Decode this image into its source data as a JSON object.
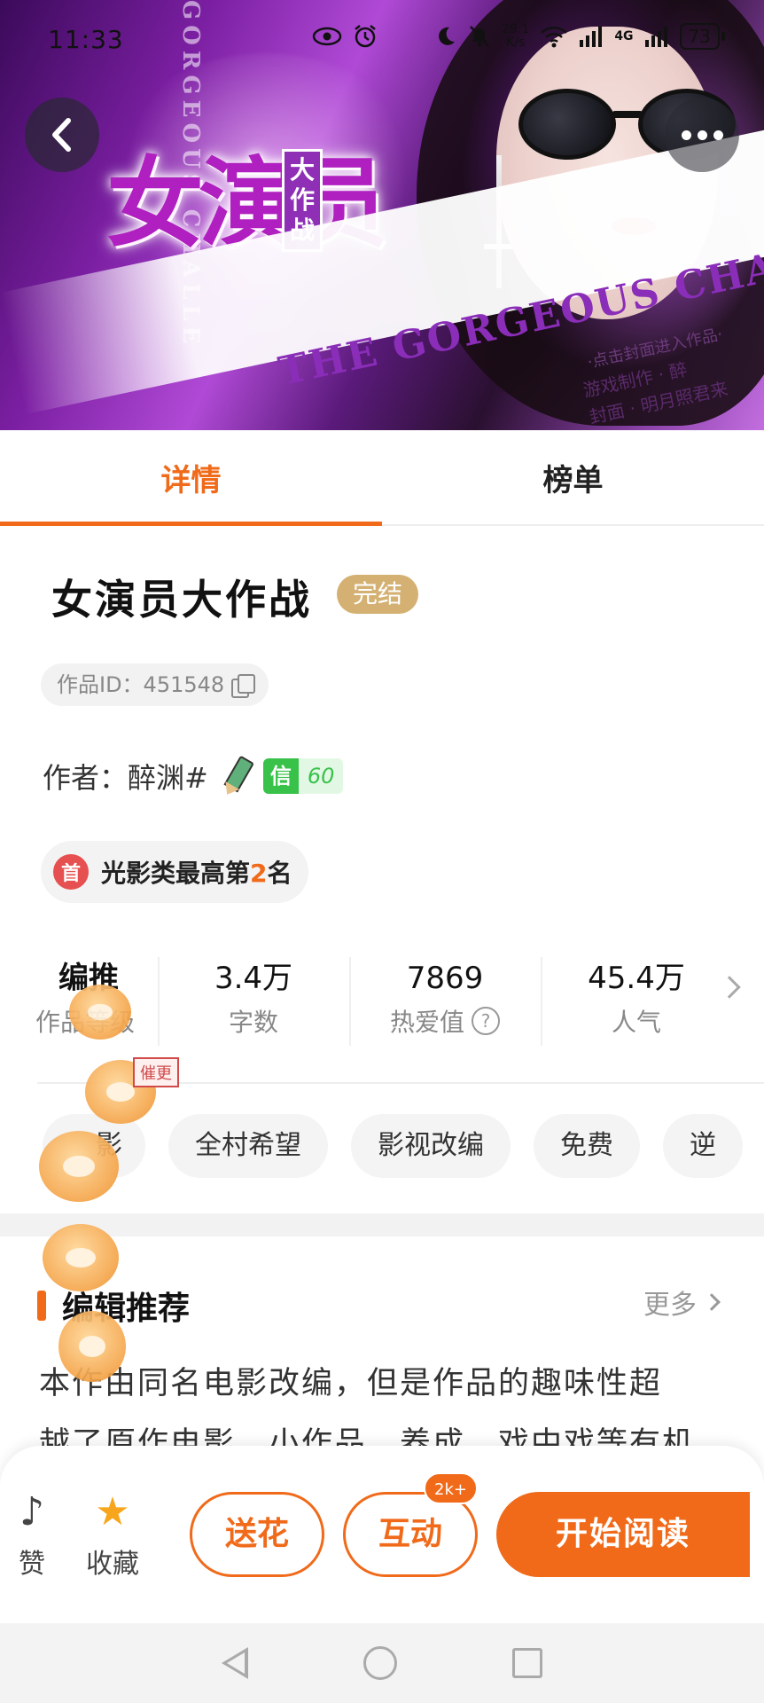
{
  "status_bar": {
    "time": "11:33",
    "net_speed": "29.1",
    "net_speed_unit": "K/s",
    "net_type": "4G",
    "battery": "73"
  },
  "cover": {
    "title_art": "女演员",
    "title_sub": "大作战",
    "vertical_text": "GORGEOUS CHALLE",
    "banner_text": "THE GORGEOUS CHALLENGE",
    "hint": "·点击封面进入作品·",
    "credit_game": "游戏制作 · 醉",
    "credit_cover": "封面 · 明月照君来"
  },
  "tabs": [
    {
      "label": "详情",
      "active": true
    },
    {
      "label": "榜单",
      "active": false
    }
  ],
  "book": {
    "title": "女演员大作战",
    "status": "完结",
    "work_id_label": "作品ID：451548",
    "author_label": "作者：醉渊#",
    "trust_key": "信",
    "trust_value": "60",
    "rank_icon_glyph": "首",
    "rank_prefix": "光影类最高第",
    "rank_number": "2",
    "rank_suffix": "名"
  },
  "stats": [
    {
      "value": "编推",
      "label": "作品等级"
    },
    {
      "value": "3.4万",
      "label": "字数"
    },
    {
      "value": "7869",
      "label": "热爱值"
    },
    {
      "value": "45.4万",
      "label": "人气"
    }
  ],
  "tags": [
    "影",
    "全村希望",
    "影视改编",
    "免费",
    "逆"
  ],
  "editor_recommend": {
    "title": "编辑推荐",
    "more": "更多",
    "text_line1": "本作由同名电影改编，但是作品的趣味性超",
    "text_line2": "越了原作电影，小作品，养成，戏中戏等有机"
  },
  "sticker_label": "催更",
  "actions": {
    "like_glyph": "♪",
    "like": "赞",
    "favorite_glyph": "★",
    "favorite": "收藏",
    "flower": "送花",
    "interact": "互动",
    "interact_badge": "2k+",
    "read": "开始阅读"
  },
  "colors": {
    "accent": "#f06a1a",
    "done_badge": "#d4b172",
    "trust_green": "#38c24a",
    "favorite_star": "#f7a51c"
  }
}
